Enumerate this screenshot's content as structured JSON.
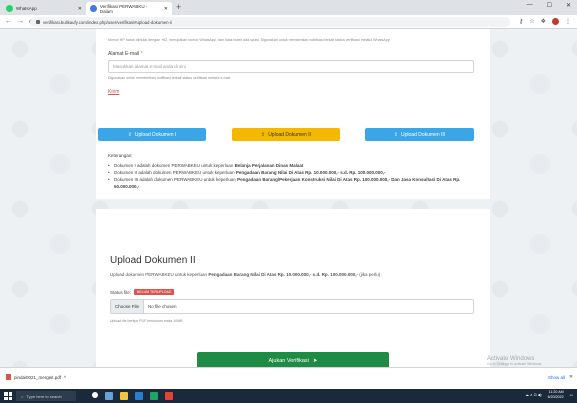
{
  "browser": {
    "tabs": [
      {
        "label": "WhatsApp"
      },
      {
        "label": "Verifikasi PERWABKU - Dalam"
      }
    ],
    "url": "verifikasi.bulikaufy.com/index.php/user/verifikasi#upload-dokumen-ii"
  },
  "form": {
    "phone_help": "Nomor HP harus dimulai dengan +62, merupakan nomor WhatsApp, dan tidak boleh ada spasi. Digunakan untuk memberikan notifikasi terkait status verifikasi melalui WhatsApp",
    "email_label": "Alamat E-mail",
    "email_required": "*",
    "email_placeholder": "Masukkan alamat e-mail anda di sini",
    "email_help": "Digunakan untuk memberikan notifikasi terkait status verifikasi melalui e-mail",
    "kirim_label": "Kirim"
  },
  "upload_buttons": [
    {
      "label": "Upload Dokumen I"
    },
    {
      "label": "Upload Dokumen II"
    },
    {
      "label": "Upload Dokumen III"
    }
  ],
  "keterangan": {
    "title": "Keterangan:",
    "items": [
      {
        "pre": "Dokumen I adalah dokumen PERWABKEU untuk keperluan ",
        "bold": "Belanja Perjalanan Dinas Malaat",
        "post": ""
      },
      {
        "pre": "Dokumen II adalah dokumen PERWABKEU untuk keperluan ",
        "bold": "Pengadaan Barang Nilai Di Atas Rp. 10.000.000,- s.d. Rp. 100.000.000,-",
        "post": ""
      },
      {
        "pre": "Dokumen III adalah dokumen PERWABKEU untuk keperluan ",
        "bold": "Pengadaan Barang/Pekerjaan Konstruksi Nilai Di Atas Rp. 100.000.000,- Dan Jasa Konsultasi Di Atas Rp. 50.000.000,-",
        "post": ""
      }
    ]
  },
  "upload_section": {
    "title": "Upload Dokumen II",
    "subtitle_pre": "Upload dokumen PERWABKEU untuk keperluan ",
    "subtitle_bold": "Pengadaan Barang Nilai Di Atas Rp. 10.000.000,- s.d. Rp. 100.000.000,-",
    "subtitle_post": " (jika perlu)",
    "status_label": "Status file:",
    "status_badge": "BELUM TERUPLOAD",
    "choose_label": "Choose File",
    "no_file": "No file chosen",
    "file_help": "Upload file bertipe PDF berukuran maks 10MB",
    "submit_label": "Ajukan Verifikasi"
  },
  "watermark": {
    "line1": "Activate Windows",
    "line2": "Go to Settings to activate Windows."
  },
  "downloads": {
    "file": "pindai0021_mergeit.pdf",
    "show_all": "Show all"
  },
  "taskbar": {
    "search_placeholder": "Type here to search",
    "time": "11:20 AM",
    "date": "6/20/2022"
  },
  "colors": {
    "blue_button": "#3aa6e8",
    "yellow_button": "#f5b800",
    "submit_green": "#1e8c45",
    "badge_red": "#d9534f"
  }
}
